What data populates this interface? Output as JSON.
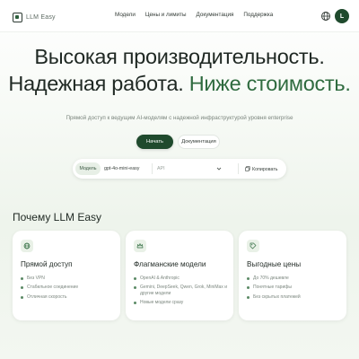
{
  "header": {
    "logo_text": "LLM Easy",
    "nav": [
      "Модели",
      "Цены и лимиты",
      "Документация",
      "Поддержка"
    ],
    "avatar_letter": "L"
  },
  "hero": {
    "title_line1": "Высокая производительность.",
    "title_line2_plain": "Надежная работа. ",
    "title_line2_accent": "Ниже стоимость.",
    "subtitle": "Прямой доступ к ведущим AI-моделям с надежной инфраструктурой уровня enterprise",
    "primary_button": "Начать",
    "secondary_button": "Документация"
  },
  "config_bar": {
    "model_label": "Модель",
    "model_value": "gpt-4o-mini-easy",
    "select_value": "API",
    "copy_label": "Копировать"
  },
  "section": {
    "title": "Почему LLM Easy",
    "cards": [
      {
        "icon": "globe-icon",
        "title": "Прямой доступ",
        "items": [
          "Без VPN",
          "Стабильное соединение",
          "Отличная скорость"
        ]
      },
      {
        "icon": "crown-icon",
        "title": "Флагманские модели",
        "items": [
          "OpenAI & Anthropic",
          "Gemini, DeepSeek, Qwen, Grok, MiniMax и другие модели",
          "Новые модели сразу"
        ]
      },
      {
        "icon": "tag-icon",
        "title": "Выгодные цены",
        "items": [
          "До 70% дешевле",
          "Понятные тарифы",
          "Без скрытых платежей"
        ]
      }
    ]
  },
  "colors": {
    "brand_dark": "#1f4a2d",
    "accent_green": "#2f6b3f",
    "icon_bg": "#e9f1e7"
  }
}
